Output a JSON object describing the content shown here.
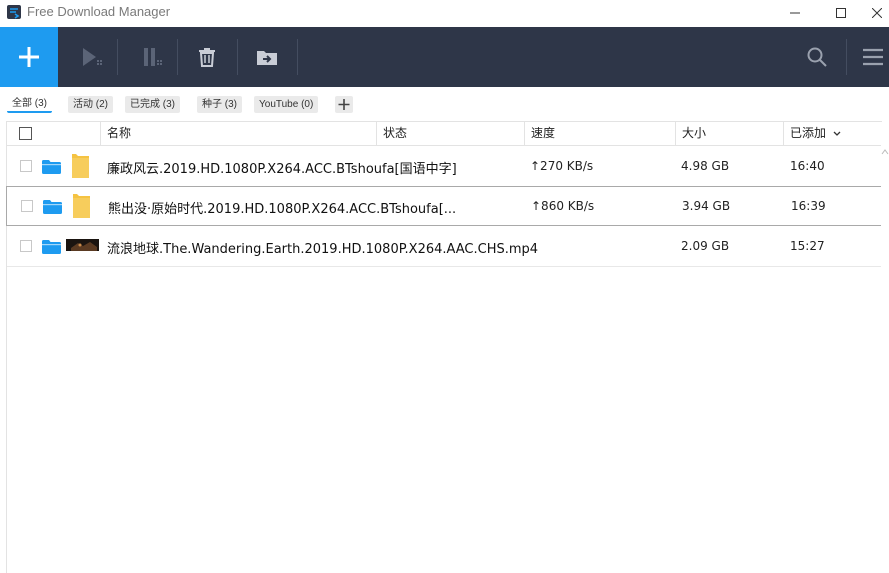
{
  "app": {
    "title": "Free Download Manager"
  },
  "filters": [
    {
      "label": "全部 (3)"
    },
    {
      "label": "活动 (2)"
    },
    {
      "label": "已完成 (3)"
    },
    {
      "label": "种子 (3)"
    },
    {
      "label": "YouTube (0)"
    }
  ],
  "columns": {
    "name": "名称",
    "status": "状态",
    "speed": "速度",
    "size": "大小",
    "added": "已添加"
  },
  "rows": [
    {
      "name": "廉政风云.2019.HD.1080P.X264.ACC.BTshoufa[国语中字]",
      "speed": "↑270 KB/s",
      "size": "4.98 GB",
      "added": "16:40"
    },
    {
      "name": "熊出没·原始时代.2019.HD.1080P.X264.ACC.BTshoufa[...",
      "speed": "↑860 KB/s",
      "size": "3.94 GB",
      "added": "16:39"
    },
    {
      "name": "流浪地球.The.Wandering.Earth.2019.HD.1080P.X264.AAC.CHS.mp4",
      "speed": "",
      "size": "2.09 GB",
      "added": "15:27"
    }
  ],
  "colors": {
    "accent": "#1e9bf0",
    "toolbar": "#2e3648",
    "folder": "#f5c342"
  }
}
